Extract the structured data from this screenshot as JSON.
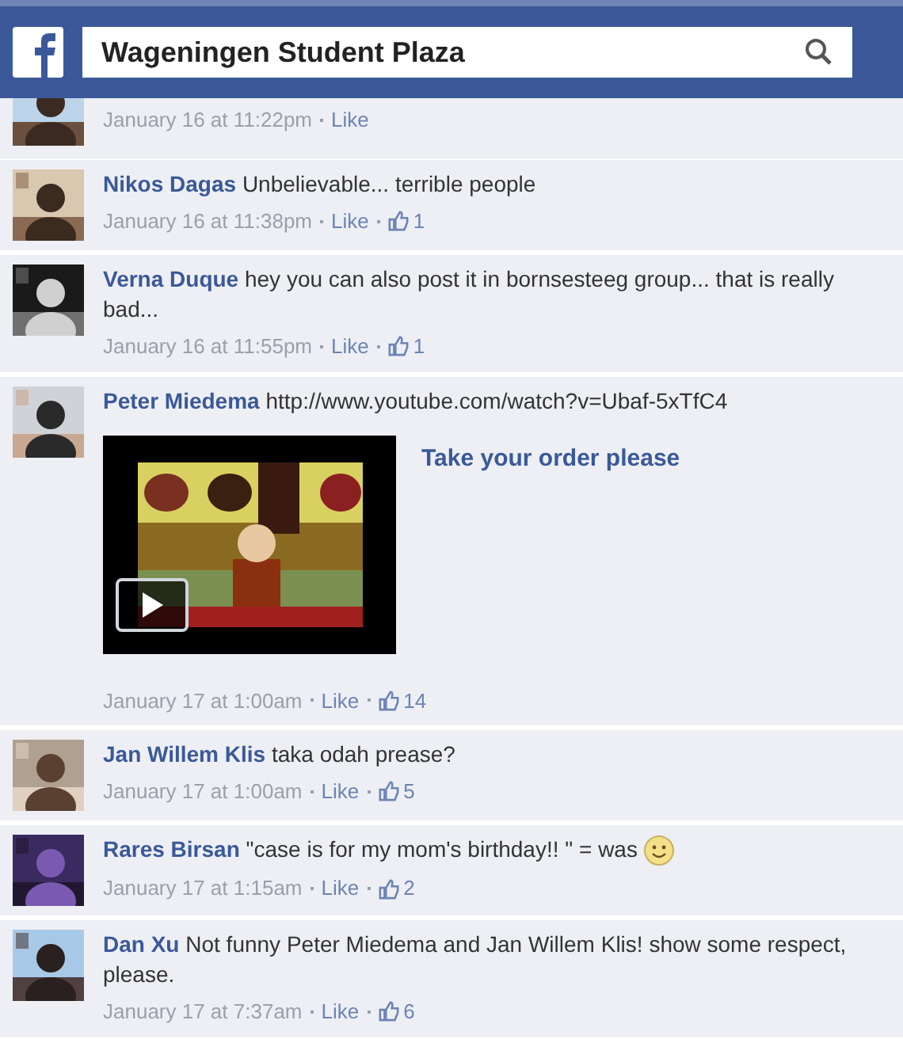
{
  "header": {
    "search": {
      "value": "Wageningen Student Plaza"
    }
  },
  "comments": [
    {
      "kind": "cut",
      "time": "January 16 at 11:22pm",
      "like": "Like"
    },
    {
      "kind": "text",
      "name": "Nikos Dagas",
      "body": "Unbelievable... terrible people",
      "time": "January 16 at 11:38pm",
      "like": "Like",
      "likes": "1"
    },
    {
      "kind": "text",
      "name": "Verna Duque",
      "body": "hey you can also post it in bornsesteeg group... that is really bad...",
      "time": "January 16 at 11:55pm",
      "like": "Like",
      "likes": "1"
    },
    {
      "kind": "video",
      "name": "Peter Miedema",
      "body": "http://www.youtube.com/watch?v=Ubaf-5xTfC4",
      "video_title": "Take your order please",
      "time": "January 17 at 1:00am",
      "like": "Like",
      "likes": "14"
    },
    {
      "kind": "text",
      "name": "Jan Willem Klis",
      "body": "taka odah prease?",
      "time": "January 17 at 1:00am",
      "like": "Like",
      "likes": "5"
    },
    {
      "kind": "text",
      "name": "Rares Birsan",
      "body": "\"case is for my mom's birthday!! \" = was",
      "emoticon": true,
      "time": "January 17 at 1:15am",
      "like": "Like",
      "likes": "2"
    },
    {
      "kind": "text",
      "name": "Dan Xu",
      "body": "Not funny Peter Miedema and Jan Willem Klis! show some respect, please.",
      "time": "January 17 at 7:37am",
      "like": "Like",
      "likes": "6"
    }
  ]
}
